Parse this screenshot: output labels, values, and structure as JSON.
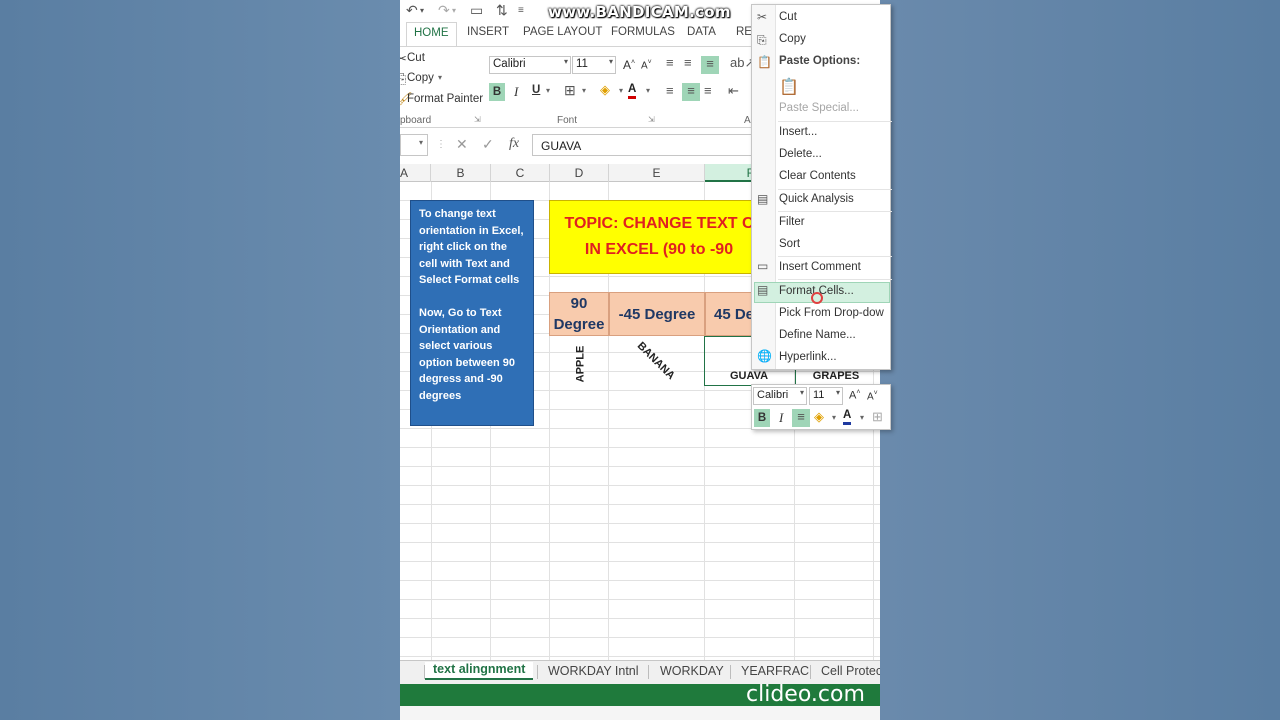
{
  "watermark": "www.BANDICAM.com",
  "ribbon": {
    "tabs": [
      "HOME",
      "INSERT",
      "PAGE LAYOUT",
      "FORMULAS",
      "DATA",
      "RE"
    ],
    "clipboard": {
      "cut": "Cut",
      "copy": "Copy",
      "format_painter": "Format Painter",
      "group": "pboard"
    },
    "font": {
      "name": "Calibri",
      "size": "11",
      "group": "Font",
      "bold": "B",
      "italic": "I",
      "underline": "U",
      "color_letter": "A"
    },
    "alignment_group": "A"
  },
  "formula_bar": {
    "fx": "fx",
    "value": "GUAVA"
  },
  "columns": [
    "A",
    "B",
    "C",
    "D",
    "E",
    "F"
  ],
  "note": "To change text orientation in Excel, right click on the cell with Text and Select Format cells\n\nNow, Go to Text Orientation and select various option between 90 degress and -90 degrees",
  "topic": {
    "line1": "TOPIC: CHANGE TEXT C",
    "line2": "IN EXCEL (90 to -90"
  },
  "headers": {
    "h90": "90\nDegree",
    "hm45": "-45 Degree",
    "h45": "45 De"
  },
  "cells": {
    "apple": "APPLE",
    "banana": "BANANA",
    "guava": "GUAVA",
    "grapes": "GRAPES"
  },
  "context_menu": {
    "cut": "Cut",
    "copy": "Copy",
    "paste_options": "Paste Options:",
    "paste_special": "Paste Special...",
    "insert": "Insert...",
    "delete": "Delete...",
    "clear_contents": "Clear Contents",
    "quick_analysis": "Quick Analysis",
    "filter": "Filter",
    "sort": "Sort",
    "insert_comment": "Insert Comment",
    "format_cells": "Format Cells...",
    "pick_from_dropdown": "Pick From Drop-dow",
    "define_name": "Define Name...",
    "hyperlink": "Hyperlink..."
  },
  "mini_toolbar": {
    "font": "Calibri",
    "size": "11",
    "bold": "B",
    "italic": "I",
    "color_letter": "A"
  },
  "sheet_tabs": [
    "text alingnment",
    "WORKDAY Intnl",
    "WORKDAY",
    "YEARFRAC",
    "Cell Protec"
  ],
  "clideo": "clideo.com"
}
